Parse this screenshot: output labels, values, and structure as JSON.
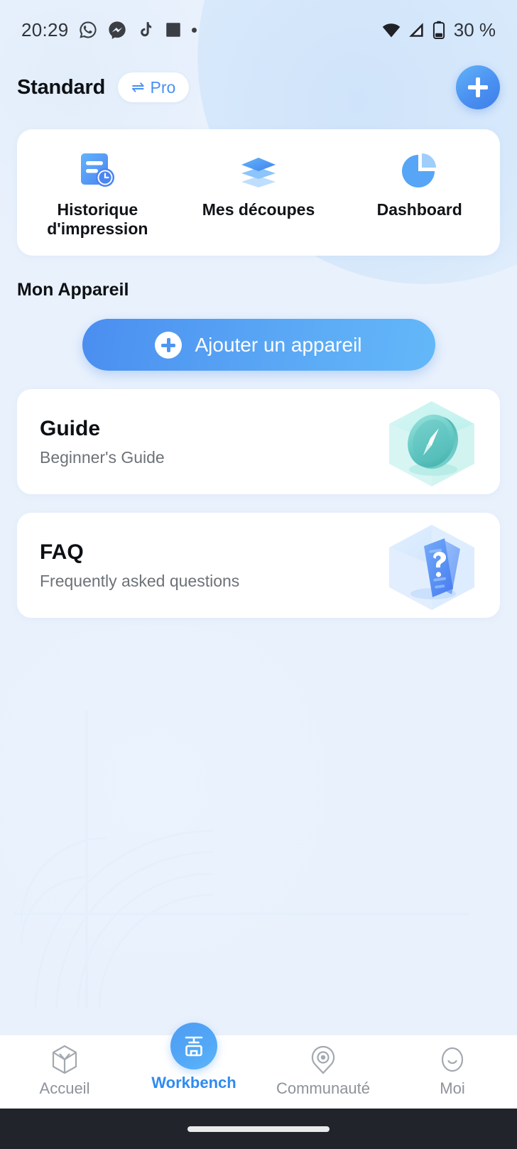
{
  "status_bar": {
    "time": "20:29",
    "left_icons": [
      "whatsapp-icon",
      "messenger-icon",
      "tiktok-icon",
      "square-app-icon",
      "dot-indicator"
    ],
    "right_icons": [
      "wifi-icon",
      "cellular-signal-icon",
      "battery-icon"
    ],
    "battery_text": "30 %"
  },
  "header": {
    "title": "Standard",
    "pro_toggle": {
      "swap_glyph": "⇌",
      "label": "Pro",
      "icon": "swap-arrows-icon"
    },
    "add_button_icon": "plus-icon"
  },
  "quick_actions": [
    {
      "label": "Historique d'impression",
      "icon": "print-history-icon"
    },
    {
      "label": "Mes découpes",
      "icon": "layers-icon"
    },
    {
      "label": "Dashboard",
      "icon": "pie-chart-icon"
    }
  ],
  "device_section": {
    "title": "Mon Appareil",
    "add_device_button": {
      "label": "Ajouter un appareil",
      "icon": "plus-circle-icon"
    }
  },
  "info_cards": [
    {
      "title": "Guide",
      "subtitle": "Beginner's Guide",
      "art": "compass-hexagon-illustration"
    },
    {
      "title": "FAQ",
      "subtitle": "Frequently asked questions",
      "art": "question-card-hexagon-illustration"
    }
  ],
  "bottom_nav": {
    "items": [
      {
        "label": "Accueil",
        "icon": "cube-icon",
        "active": false
      },
      {
        "label": "Workbench",
        "icon": "printer-icon",
        "active": true
      },
      {
        "label": "Communauté",
        "icon": "community-pin-icon",
        "active": false
      },
      {
        "label": "Moi",
        "icon": "smiley-face-icon",
        "active": false
      }
    ]
  },
  "colors": {
    "background": "#e9f1fc",
    "card": "#ffffff",
    "accent_blue": "#4a90f2",
    "accent_blue_light": "#63b8f9",
    "text_primary": "#0d1014",
    "text_secondary": "#6d7277",
    "nav_inactive": "#8d939a",
    "guide_art_teal": "#5fc9c4",
    "gesture_bar": "#21252b"
  }
}
